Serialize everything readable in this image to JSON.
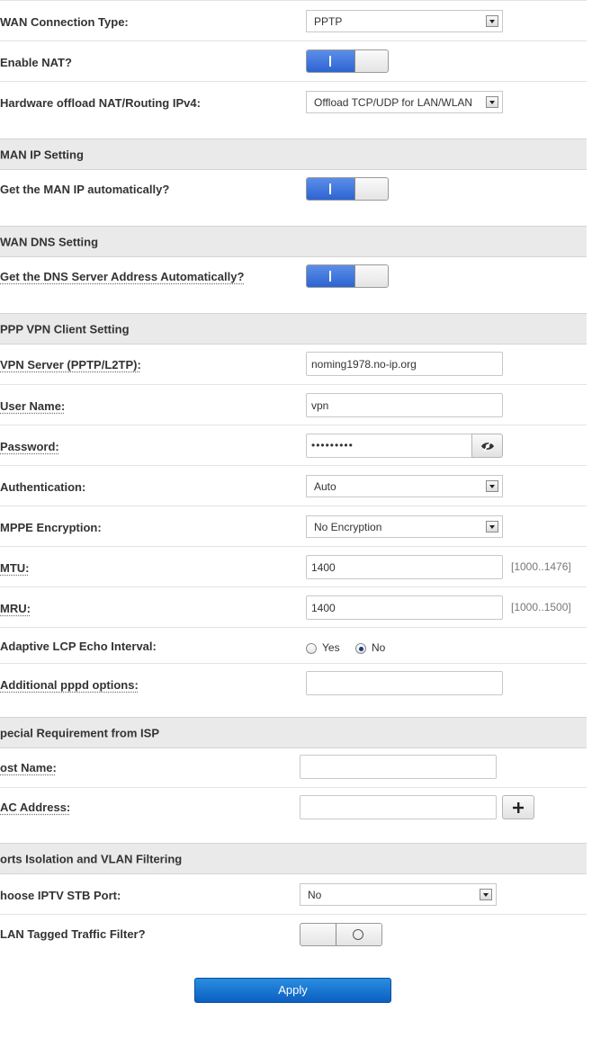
{
  "wan": {
    "connection_type_label": "WAN Connection Type:",
    "connection_type_value": "PPTP",
    "nat_label": "Enable NAT?",
    "offload_label": "Hardware offload NAT/Routing IPv4:",
    "offload_value": "Offload TCP/UDP for LAN/WLAN"
  },
  "man_ip": {
    "section_title": "MAN IP Setting",
    "auto_label": "Get the MAN IP automatically?"
  },
  "wan_dns": {
    "section_title": "WAN DNS Setting",
    "auto_label": "Get the DNS Server Address Automatically?"
  },
  "ppp_vpn": {
    "section_title": "PPP VPN Client Setting",
    "server_label": "VPN Server (PPTP/L2TP):",
    "server_value": "noming1978.no-ip.org",
    "username_label": "User Name:",
    "username_value": "vpn",
    "password_label": "Password:",
    "password_value": "•••••••••",
    "auth_label": "Authentication:",
    "auth_value": "Auto",
    "mppe_label": "MPPE Encryption:",
    "mppe_value": "No Encryption",
    "mtu_label": "MTU:",
    "mtu_value": "1400",
    "mtu_range": "[1000..1476]",
    "mru_label": "MRU:",
    "mru_value": "1400",
    "mru_range": "[1000..1500]",
    "lcp_label": "Adaptive LCP Echo Interval:",
    "lcp_yes": "Yes",
    "lcp_no": "No",
    "lcp_selected": "No",
    "pppd_label": "Additional pppd options:",
    "pppd_value": ""
  },
  "isp": {
    "section_title": "pecial Requirement from ISP",
    "host_label": "ost Name:",
    "host_value": "",
    "mac_label": "AC Address:",
    "mac_value": ""
  },
  "ports": {
    "section_title": "orts Isolation and VLAN Filtering",
    "iptv_label": "hoose IPTV STB Port:",
    "iptv_value": "No",
    "vlan_label": "LAN Tagged Traffic Filter?"
  },
  "actions": {
    "apply_label": "Apply"
  },
  "colors": {
    "toggle_on": "#2c64d2",
    "apply_button": "#0b5fc2",
    "section_header_bg": "#eaeaea"
  },
  "icons": {
    "select_arrow": "chevron-down-icon",
    "password_reveal": "eye-icon",
    "mac_add": "plus-icon",
    "toggle_off": "circle-icon"
  }
}
